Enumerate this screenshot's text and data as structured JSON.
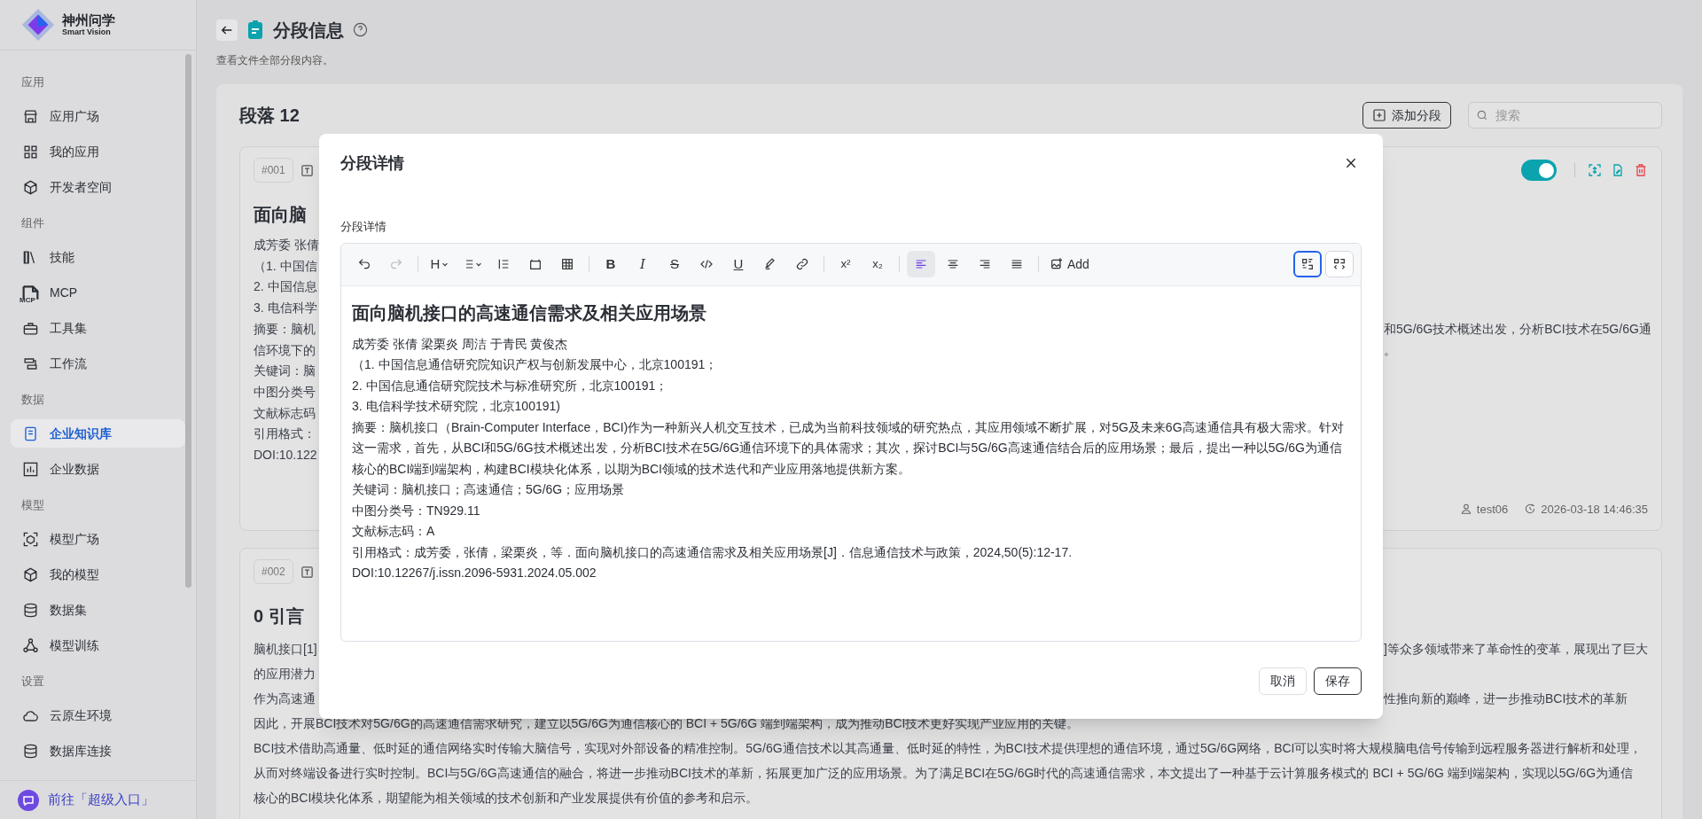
{
  "sidebar": {
    "logo": {
      "title": "神州问学",
      "subtitle": "Smart Vision"
    },
    "sections": [
      {
        "title": "应用",
        "items": [
          {
            "label": "应用广场",
            "selected": false
          },
          {
            "label": "我的应用",
            "selected": false
          },
          {
            "label": "开发者空间",
            "selected": false
          }
        ]
      },
      {
        "title": "组件",
        "items": [
          {
            "label": "技能",
            "selected": false
          },
          {
            "label": "MCP",
            "icon_text": "MCP",
            "selected": false
          },
          {
            "label": "工具集",
            "selected": false
          },
          {
            "label": "工作流",
            "selected": false
          }
        ]
      },
      {
        "title": "数据",
        "items": [
          {
            "label": "企业知识库",
            "selected": true
          },
          {
            "label": "企业数据",
            "selected": false
          }
        ]
      },
      {
        "title": "模型",
        "items": [
          {
            "label": "模型广场",
            "selected": false
          },
          {
            "label": "我的模型",
            "selected": false
          },
          {
            "label": "数据集",
            "selected": false
          },
          {
            "label": "模型训练",
            "selected": false
          }
        ]
      },
      {
        "title": "设置",
        "items": [
          {
            "label": "云原生环境",
            "selected": false
          },
          {
            "label": "数据库连接",
            "selected": false
          }
        ]
      }
    ],
    "footer_link": "前往「超级入口」"
  },
  "header": {
    "title": "分段信息",
    "subtitle": "查看文件全部分段内容。"
  },
  "panel": {
    "title": "段落 12",
    "add_button": "添加分段",
    "search": {
      "placeholder": "搜索"
    }
  },
  "cards": [
    {
      "badge": "#001",
      "enabled": true,
      "title": "面向脑",
      "lines": [
        {
          "left": "成芳委 张倩"
        },
        {
          "left": "（1. 中国信"
        },
        {
          "left": "2. 中国信息"
        },
        {
          "left": "3. 电信科学"
        },
        {
          "left": "摘要：脑机",
          "right": "和5G/6G技术概述出发，分析BCI技术在5G/6G通"
        },
        {
          "left": "信环境下的",
          "right": "。"
        },
        {
          "left": "关键词：脑"
        },
        {
          "left": "中图分类号"
        },
        {
          "left": "文献标志码"
        },
        {
          "left": "引用格式："
        },
        {
          "left": "DOI:10.122"
        }
      ],
      "author": "test06",
      "time": "2026-03-18 14:46:35"
    },
    {
      "badge": "#002",
      "title": "0 引言",
      "lines": [
        {
          "left": "脑机接口[1]",
          "right": "]等众多领域带来了革命性的变革，展现出了巨大"
        },
        {
          "left": "的应用潜力"
        },
        {
          "left": "作为高速通",
          "right": "性推向新的巅峰，进一步推动BCI技术的革新"
        },
        {
          "full": "因此，开展BCI技术对5G/6G的高速通信需求研究，建立以5G/6G为通信核心的 BCI + 5G/6G 端到端架构，成为推动BCI技术更好实现产业应用的关键。"
        },
        {
          "full": "BCI技术借助高通量、低时延的通信网络实时传输大脑信号，实现对外部设备的精准控制。5G/6G通信技术以其高通量、低时延的特性，为BCI技术提供理想的通信环境，通过5G/6G网络，BCI可以实时将大规模脑电信号传输到远程服务器进行解析和处理，"
        },
        {
          "full": "从而对终端设备进行实时控制。BCI与5G/6G高速通信的融合，将进一步推动BCI技术的革新，拓展更加广泛的应用场景。为了满足BCI在5G/6G时代的高速通信需求，本文提出了一种基于云计算服务模式的 BCI + 5G/6G 端到端架构，实现以5G/6G为通信"
        },
        {
          "full": "核心的BCI模块化体系，期望能为相关领域的技术创新和产业发展提供有价值的参考和启示。"
        }
      ]
    }
  ],
  "modal": {
    "title": "分段详情",
    "field_label": "分段详情",
    "toolbar": {
      "undo": {
        "disabled": false
      },
      "redo": {
        "disabled": true
      },
      "heading": "H",
      "bold": "B",
      "italic": "I",
      "strike": "S",
      "underline": "U",
      "superscript": "x²",
      "subscript": "x₂",
      "add_image": "Add",
      "align": [
        {
          "selected": true
        },
        {
          "selected": false
        },
        {
          "selected": false
        },
        {
          "selected": false
        }
      ],
      "view_modes": [
        {
          "selected": true
        },
        {
          "selected": false
        }
      ]
    },
    "content": [
      {
        "kind": "heading",
        "text": "面向脑机接口的高速通信需求及相关应用场景"
      },
      {
        "kind": "paragraph",
        "text": "成芳委 张倩 梁栗炎 周洁 于青民 黄俊杰"
      },
      {
        "kind": "paragraph",
        "text": "（1. 中国信息通信研究院知识产权与创新发展中心，北京100191；"
      },
      {
        "kind": "paragraph",
        "text": "2. 中国信息通信研究院技术与标准研究所，北京100191；"
      },
      {
        "kind": "paragraph",
        "text": "3. 电信科学技术研究院，北京100191)"
      },
      {
        "kind": "paragraph",
        "text": "摘要：脑机接口（Brain-Computer Interface，BCI)作为一种新兴人机交互技术，已成为当前科技领域的研究热点，其应用领域不断扩展，对5G及未来6G高速通信具有极大需求。针对这一需求，首先，从BCI和5G/6G技术概述出发，分析BCI技术在5G/6G通信环境下的具体需求；其次，探讨BCI与5G/6G高速通信结合后的应用场景；最后，提出一种以5G/6G为通信核心的BCI端到端架构，构建BCI模块化体系，以期为BCI领域的技术迭代和产业应用落地提供新方案。"
      },
      {
        "kind": "paragraph",
        "text": "关键词：脑机接口；高速通信；5G/6G；应用场景"
      },
      {
        "kind": "paragraph",
        "text": "中图分类号：TN929.11"
      },
      {
        "kind": "paragraph",
        "text": "文献标志码：A"
      },
      {
        "kind": "paragraph",
        "text": "引用格式：成芳委，张倩，梁栗炎，等．面向脑机接口的高速通信需求及相关应用场景[J]．信息通信技术与政策，2024,50(5):12-17."
      },
      {
        "kind": "paragraph",
        "text": "DOI:10.12267/j.issn.2096-5931.2024.05.002"
      }
    ],
    "cancel": "取消",
    "save": "保存"
  }
}
